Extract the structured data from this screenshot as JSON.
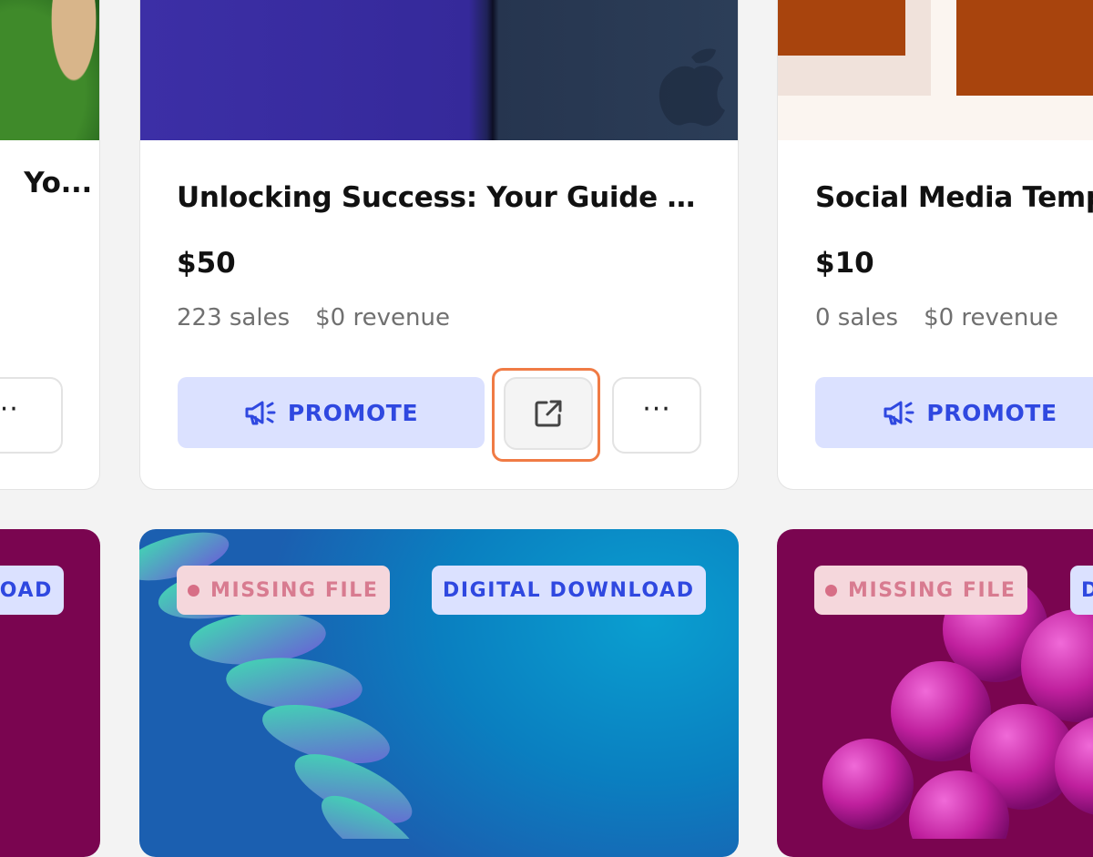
{
  "cards": [
    {
      "title": "Unlocking Success: Your Guide to...",
      "price": "$50",
      "sales": "223 sales",
      "revenue": "$0 revenue",
      "promote_label": "PROMOTE",
      "more_label": "···"
    },
    {
      "title": "Social Media Templates",
      "price": "$10",
      "sales": "0 sales",
      "revenue": "$0 revenue",
      "promote_label": "PROMOTE"
    },
    {
      "title": "Yo...",
      "more_label": "···"
    }
  ],
  "badges": {
    "missing_file": "MISSING FILE",
    "digital_download": "DIGITAL DOWNLOAD",
    "left_partial": "OAD",
    "right_partial": "D"
  },
  "icons": {
    "open_external": "open-external-icon",
    "promote": "megaphone-icon",
    "more": "more-horizontal-icon"
  },
  "colors": {
    "accent_blue": "#2f48e0",
    "promote_bg": "#dbe1ff",
    "missing_bg": "#f5d7dc",
    "missing_text": "#d87b90",
    "focus_outline": "#f07b45"
  }
}
